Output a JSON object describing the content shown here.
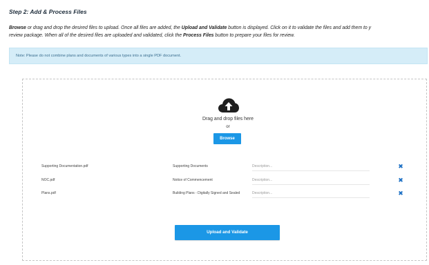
{
  "step_title": "Step 2: Add & Process Files",
  "instructions": {
    "l1_a": "Browse",
    "l1_b": " or drag and drop the desired files to upload. Once all files are added, the ",
    "l1_c": "Upload and Validate",
    "l1_d": " button is displayed. Click on it to validate the files and add them to y",
    "l2_a": "review package. When all of the desired files are uploaded and validated, click the ",
    "l2_b": "Process Files",
    "l2_c": " button to prepare your files for review."
  },
  "note": "Note: Please do not combine plans and documents of various types into a single PDF document.",
  "dropzone": {
    "icon": "cloud-upload-icon",
    "drag_text": "Drag and drop files here",
    "or_text": "or",
    "browse_label": "Browse"
  },
  "files": [
    {
      "name": "Supporting Documentation.pdf",
      "type": "Supporting Documents",
      "description_placeholder": "Description..."
    },
    {
      "name": "NOC.pdf",
      "type": "Notice of Commencement",
      "description_placeholder": "Description..."
    },
    {
      "name": "Plans.pdf",
      "type": "Building Plans - Digitally Signed and Sealed",
      "description_placeholder": "Description..."
    }
  ],
  "upload_label": "Upload and Validate",
  "colors": {
    "accent": "#1b97e6",
    "note_bg": "#d5edf8",
    "remove": "#1b6fc4"
  }
}
